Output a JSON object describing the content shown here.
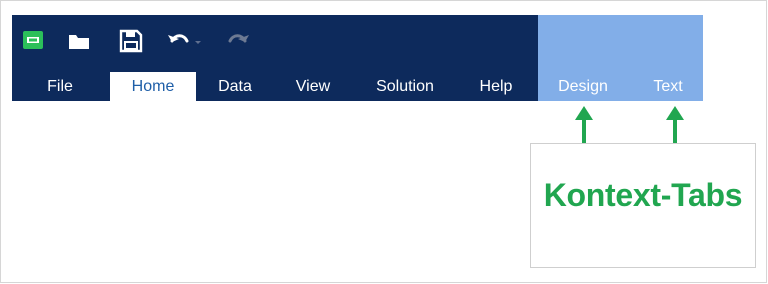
{
  "toolbar": {
    "icons": [
      "app-logo-icon",
      "open-folder-icon",
      "save-icon",
      "undo-icon",
      "redo-icon"
    ]
  },
  "tabs": [
    {
      "label": "File",
      "state": "normal"
    },
    {
      "label": "Home",
      "state": "active"
    },
    {
      "label": "Data",
      "state": "normal"
    },
    {
      "label": "View",
      "state": "normal"
    },
    {
      "label": "Solution",
      "state": "normal"
    },
    {
      "label": "Help",
      "state": "normal"
    },
    {
      "label": "Design",
      "state": "contextual"
    },
    {
      "label": "Text",
      "state": "contextual"
    }
  ],
  "callout": {
    "text": "Kontext-Tabs"
  },
  "colors": {
    "ribbon": "#0d2a5c",
    "contextual_band": "#82aee8",
    "active_tab_text": "#1f5fa8",
    "annotation_green": "#21a650"
  }
}
